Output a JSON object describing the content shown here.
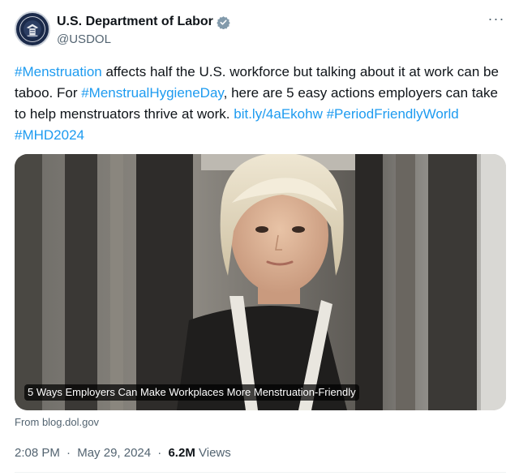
{
  "author": {
    "display_name": "U.S. Department of Labor",
    "handle": "@USDOL",
    "verified_badge_color": "#829aab"
  },
  "menu": {
    "more_label": "···"
  },
  "tweet": {
    "segments": [
      {
        "text": "#Menstruation",
        "link": true
      },
      {
        "text": " affects half the U.S. workforce but talking about it at work can be taboo. For ",
        "link": false
      },
      {
        "text": "#MenstrualHygieneDay",
        "link": true
      },
      {
        "text": ", here are 5 easy actions employers can take to help menstruators thrive at work. ",
        "link": false
      },
      {
        "text": "bit.ly/4aEkohw",
        "link": true
      },
      {
        "text": " ",
        "link": false
      },
      {
        "text": "#PeriodFriendlyWorld",
        "link": true
      },
      {
        "text": " ",
        "link": false
      },
      {
        "text": "#MHD2024",
        "link": true
      }
    ]
  },
  "card": {
    "title": "5 Ways Employers Can Make Workplaces More Menstruation-Friendly",
    "source": "From blog.dol.gov"
  },
  "meta": {
    "time": "2:08 PM",
    "separator": "·",
    "date": "May 29, 2024",
    "views_count": "6.2M",
    "views_label": "Views"
  },
  "colors": {
    "link": "#1d9bf0",
    "text": "#0f1419",
    "secondary": "#536471"
  }
}
